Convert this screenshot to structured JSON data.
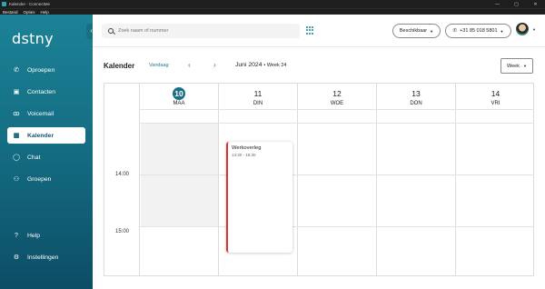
{
  "window": {
    "title": "Kalender - ConnectMe",
    "controls": [
      "—",
      "▢",
      "✕"
    ]
  },
  "menubar": [
    "Bestand",
    "Opties",
    "Help"
  ],
  "sidebar": {
    "logo": "dstny",
    "collapse_icon": "chevron-left-icon",
    "items": [
      {
        "label": "Oproepen",
        "icon": "phone-icon",
        "glyph": "✆",
        "active": false
      },
      {
        "label": "Contacten",
        "icon": "contacts-icon",
        "glyph": "▣",
        "active": false
      },
      {
        "label": "Voicemail",
        "icon": "voicemail-icon",
        "glyph": "ꝏ",
        "active": false
      },
      {
        "label": "Kalender",
        "icon": "calendar-icon",
        "glyph": "▦",
        "active": true
      },
      {
        "label": "Chat",
        "icon": "chat-icon",
        "glyph": "◯",
        "active": false
      },
      {
        "label": "Groepen",
        "icon": "groups-icon",
        "glyph": "⚇",
        "active": false
      }
    ],
    "bottom_items": [
      {
        "label": "Help",
        "icon": "help-icon",
        "glyph": "?"
      },
      {
        "label": "Instellingen",
        "icon": "settings-icon",
        "glyph": "⚙"
      }
    ]
  },
  "topbar": {
    "search_placeholder": "Zoek naam of nummer",
    "availability": "Beschikbaar",
    "phone_number": "+31 85 018 5801"
  },
  "calendar": {
    "title": "Kalender",
    "today_label": "Vandaag",
    "range": "Juni 2024",
    "week": "• Week 24",
    "view_label": "Week",
    "days": [
      {
        "num": "10",
        "name": "MAA",
        "today": true
      },
      {
        "num": "11",
        "name": "DIN",
        "today": false
      },
      {
        "num": "12",
        "name": "WOE",
        "today": false
      },
      {
        "num": "13",
        "name": "DON",
        "today": false
      },
      {
        "num": "14",
        "name": "VRI",
        "today": false
      }
    ],
    "time_labels": [
      "14:00",
      "15:00"
    ],
    "event": {
      "title": "Werkoverleg",
      "time": "13:30 - 15:30"
    }
  },
  "colors": {
    "accent": "#1c8296",
    "today": "#1c6f85",
    "event_bar": "#d93434"
  }
}
